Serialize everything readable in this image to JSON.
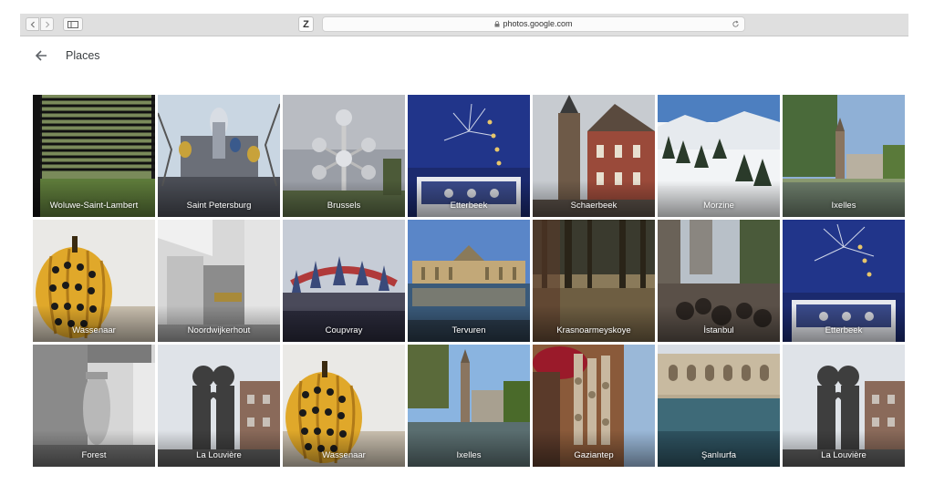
{
  "browser": {
    "url": "photos.google.com",
    "favorite_letter": "Z"
  },
  "header": {
    "title": "Places"
  },
  "places": [
    {
      "name": "Woluwe-Saint-Lambert"
    },
    {
      "name": "Saint Petersburg"
    },
    {
      "name": "Brussels"
    },
    {
      "name": "Etterbeek"
    },
    {
      "name": "Schaerbeek"
    },
    {
      "name": "Morzine"
    },
    {
      "name": "Ixelles"
    },
    {
      "name": "Wassenaar"
    },
    {
      "name": "Noordwijkerhout"
    },
    {
      "name": "Coupvray"
    },
    {
      "name": "Tervuren"
    },
    {
      "name": "Krasnoarmeyskoye"
    },
    {
      "name": "İstanbul"
    },
    {
      "name": "Etterbeek"
    },
    {
      "name": "Forest"
    },
    {
      "name": "La Louvière"
    },
    {
      "name": "Wassenaar"
    },
    {
      "name": "Ixelles"
    },
    {
      "name": "Gaziantep"
    },
    {
      "name": "Şanlıurfa"
    },
    {
      "name": "La Louvière"
    }
  ]
}
